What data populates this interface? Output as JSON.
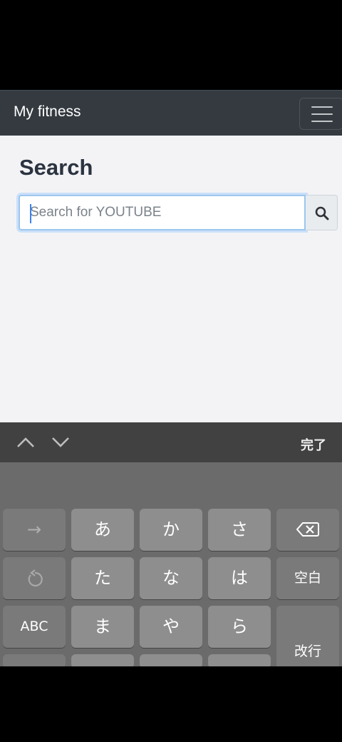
{
  "navbar": {
    "brand": "My fitness",
    "menu_icon": "hamburger-icon"
  },
  "main": {
    "title": "Search"
  },
  "search": {
    "placeholder": "Search for YOUTUBE",
    "value": "",
    "button_icon": "search-icon"
  },
  "accessory": {
    "done_label": "完了",
    "prev_icon": "chevron-up-icon",
    "next_icon": "chevron-down-icon"
  },
  "keyboard": {
    "row1": [
      "→",
      "あ",
      "か",
      "さ"
    ],
    "row2": [
      "↺",
      "た",
      "な",
      "は",
      "空白"
    ],
    "row3": [
      "ABC",
      "ま",
      "や",
      "ら",
      "改行"
    ],
    "backspace_icon": "backspace-icon",
    "undo_icon": "undo-icon"
  },
  "colors": {
    "navbar": "#343a40",
    "content_bg": "#f3f3f6",
    "focus_ring": "#9cc6ee",
    "keyboard_bg": "#6b6b6b"
  }
}
